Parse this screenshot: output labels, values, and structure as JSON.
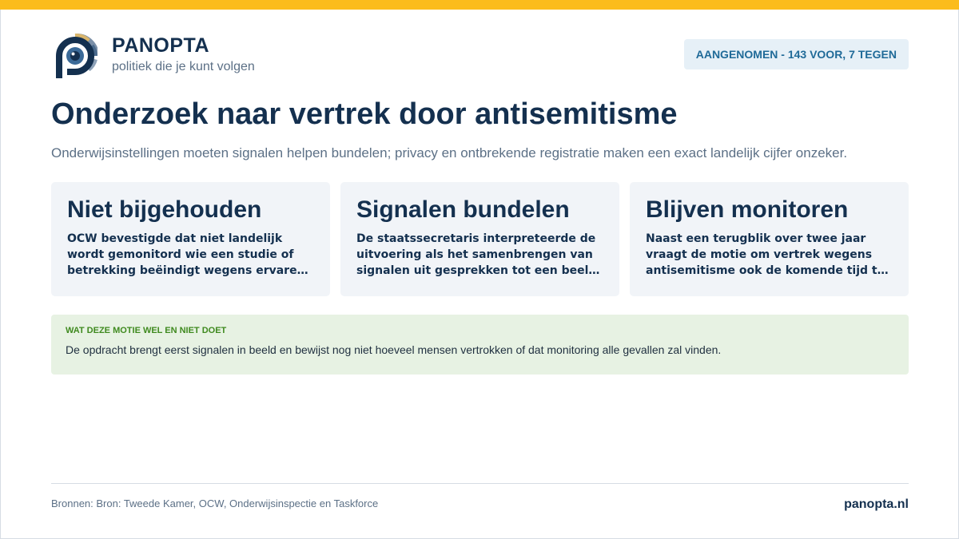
{
  "header": {
    "brand": "PANOPTA",
    "tagline": "politiek die je kunt volgen",
    "status_badge": "AANGENOMEN - 143 VOOR, 7 TEGEN"
  },
  "main": {
    "title": "Onderzoek naar vertrek door antisemitisme",
    "subtitle": "Onderwijsinstellingen moeten signalen helpen bundelen; privacy en ontbrekende registratie maken een exact landelijk cijfer onzeker.",
    "cards": [
      {
        "heading": "Niet bijgehouden",
        "body": "OCW bevestigde dat niet landelijk wordt gemonitord wie een studie of betrekking beëindigt wegens ervaren antisemitisme of de instelling verlaat."
      },
      {
        "heading": "Signalen bundelen",
        "body": "De staatssecretaris interpreteerde de uitvoering als het samenbrengen van signalen uit gesprekken tot een beeld van de situatie."
      },
      {
        "heading": "Blijven monitoren",
        "body": "Naast een terugblik over twee jaar vraagt de motie om vertrek wegens antisemitisme ook de komende tijd te blijven volgen."
      }
    ],
    "note": {
      "label": "WAT DEZE MOTIE WEL EN NIET DOET",
      "text": "De opdracht brengt eerst signalen in beeld en bewijst nog niet hoeveel mensen vertrokken of dat monitoring alle gevallen zal vinden."
    }
  },
  "footer": {
    "sources": "Bronnen: Bron: Tweede Kamer, OCW, Onderwijsinspectie en Taskforce",
    "site": "panopta.nl"
  },
  "colors": {
    "accent_bar": "#fbbc1c",
    "navy": "#14304f",
    "badge_bg": "#e6f0f7",
    "badge_text": "#1f6a98",
    "note_bg": "#e7f2e3",
    "note_label": "#3f8a1f"
  },
  "icons": {
    "logo": "panopta-eye-logo-icon"
  }
}
